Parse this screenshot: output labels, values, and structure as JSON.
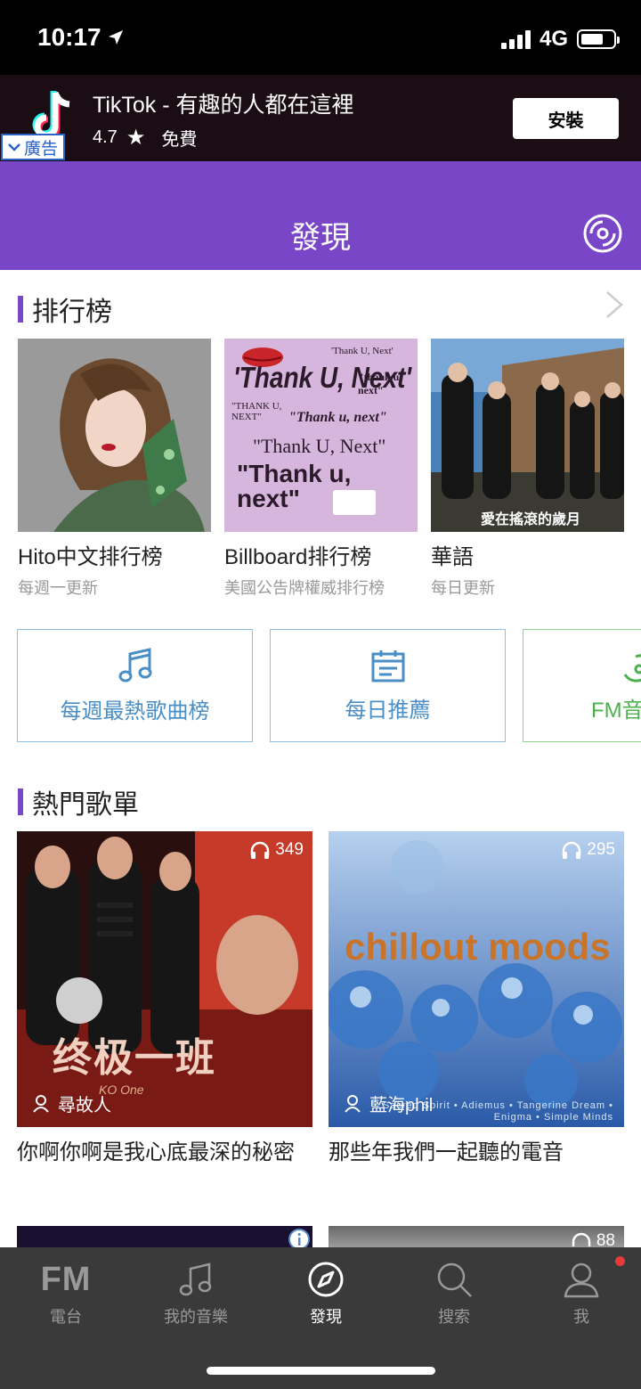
{
  "status_bar": {
    "time": "10:17",
    "network": "4G"
  },
  "ad": {
    "title": "TikTok - 有趣的人都在這裡",
    "rating": "4.7",
    "price": "免費",
    "tag": "廣告",
    "install_label": "安裝"
  },
  "header": {
    "title": "發現"
  },
  "ranking": {
    "title": "排行榜",
    "items": [
      {
        "name": "Hito中文排行榜",
        "subtitle": "每週一更新"
      },
      {
        "name": "Billboard排行榜",
        "subtitle": "美國公告牌權威排行榜"
      },
      {
        "name": "華語",
        "subtitle": "每日更新"
      }
    ],
    "billboard_art_lines": [
      "'Thank U, Next'",
      "\"thank u, next\"",
      "\"THANK U, NEXT\"",
      "\"Thank u, next\"",
      "\"Thank U, Next\"",
      "\"Thank u, next\""
    ],
    "chinese_art_caption": "愛在搖滾的歲月"
  },
  "categories": [
    {
      "label": "每週最熱歌曲榜",
      "icon": "music-note-icon"
    },
    {
      "label": "每日推薦",
      "icon": "calendar-icon"
    },
    {
      "label": "FM音",
      "icon": "guitar-icon"
    }
  ],
  "hot_playlists": {
    "title": "熱門歌單",
    "items": [
      {
        "count": "349",
        "owner": "尋故人",
        "name": "你啊你啊是我心底最深的秘密",
        "art_text": "终极一班",
        "art_sub": "KO One"
      },
      {
        "count": "295",
        "owner": "藍海phil",
        "name": "那些年我們一起聽的電音",
        "art_text": "chillout moods",
        "art_sub": "Sacred Spirit • Adiemus • Tangerine Dream • Enigma • Simple Minds"
      }
    ],
    "peek_count": "88"
  },
  "tabs": [
    {
      "label": "電台",
      "icon": "fm-icon",
      "icon_text": "FM"
    },
    {
      "label": "我的音樂",
      "icon": "music-note-icon"
    },
    {
      "label": "發現",
      "icon": "compass-icon",
      "active": true
    },
    {
      "label": "搜索",
      "icon": "search-icon"
    },
    {
      "label": "我",
      "icon": "user-icon"
    }
  ],
  "colors": {
    "accent": "#7a46c8",
    "tabbar": "#3a3a3a",
    "link_blue": "#4a8ec6",
    "green": "#4cb04c"
  }
}
